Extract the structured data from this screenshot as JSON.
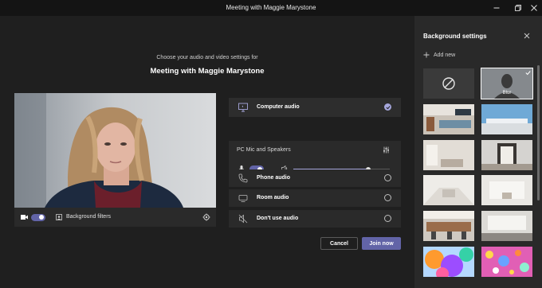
{
  "window": {
    "title": "Meeting with Maggie Marystone"
  },
  "prejoin": {
    "subtitle": "Choose your audio and video settings for",
    "meeting_title": "Meeting with Maggie Marystone",
    "video_bar": {
      "background_filters_label": "Background filters",
      "camera_on": true
    },
    "audio": {
      "computer_audio_label": "Computer audio",
      "device_label": "PC Mic and Speakers",
      "mic_on": true,
      "speaker_volume": 0.78,
      "phone_audio_label": "Phone audio",
      "room_audio_label": "Room audio",
      "dont_use_audio_label": "Don't use audio",
      "selected": "computer_audio"
    },
    "cancel_label": "Cancel",
    "join_label": "Join now"
  },
  "background_settings": {
    "title": "Background settings",
    "add_new_label": "Add new",
    "blur_label": "Blur",
    "selected": "blur"
  },
  "colors": {
    "accent": "#6264a7",
    "accent_light": "#a6a7dc",
    "bg": "#1f1f1f",
    "panel": "#292929"
  }
}
